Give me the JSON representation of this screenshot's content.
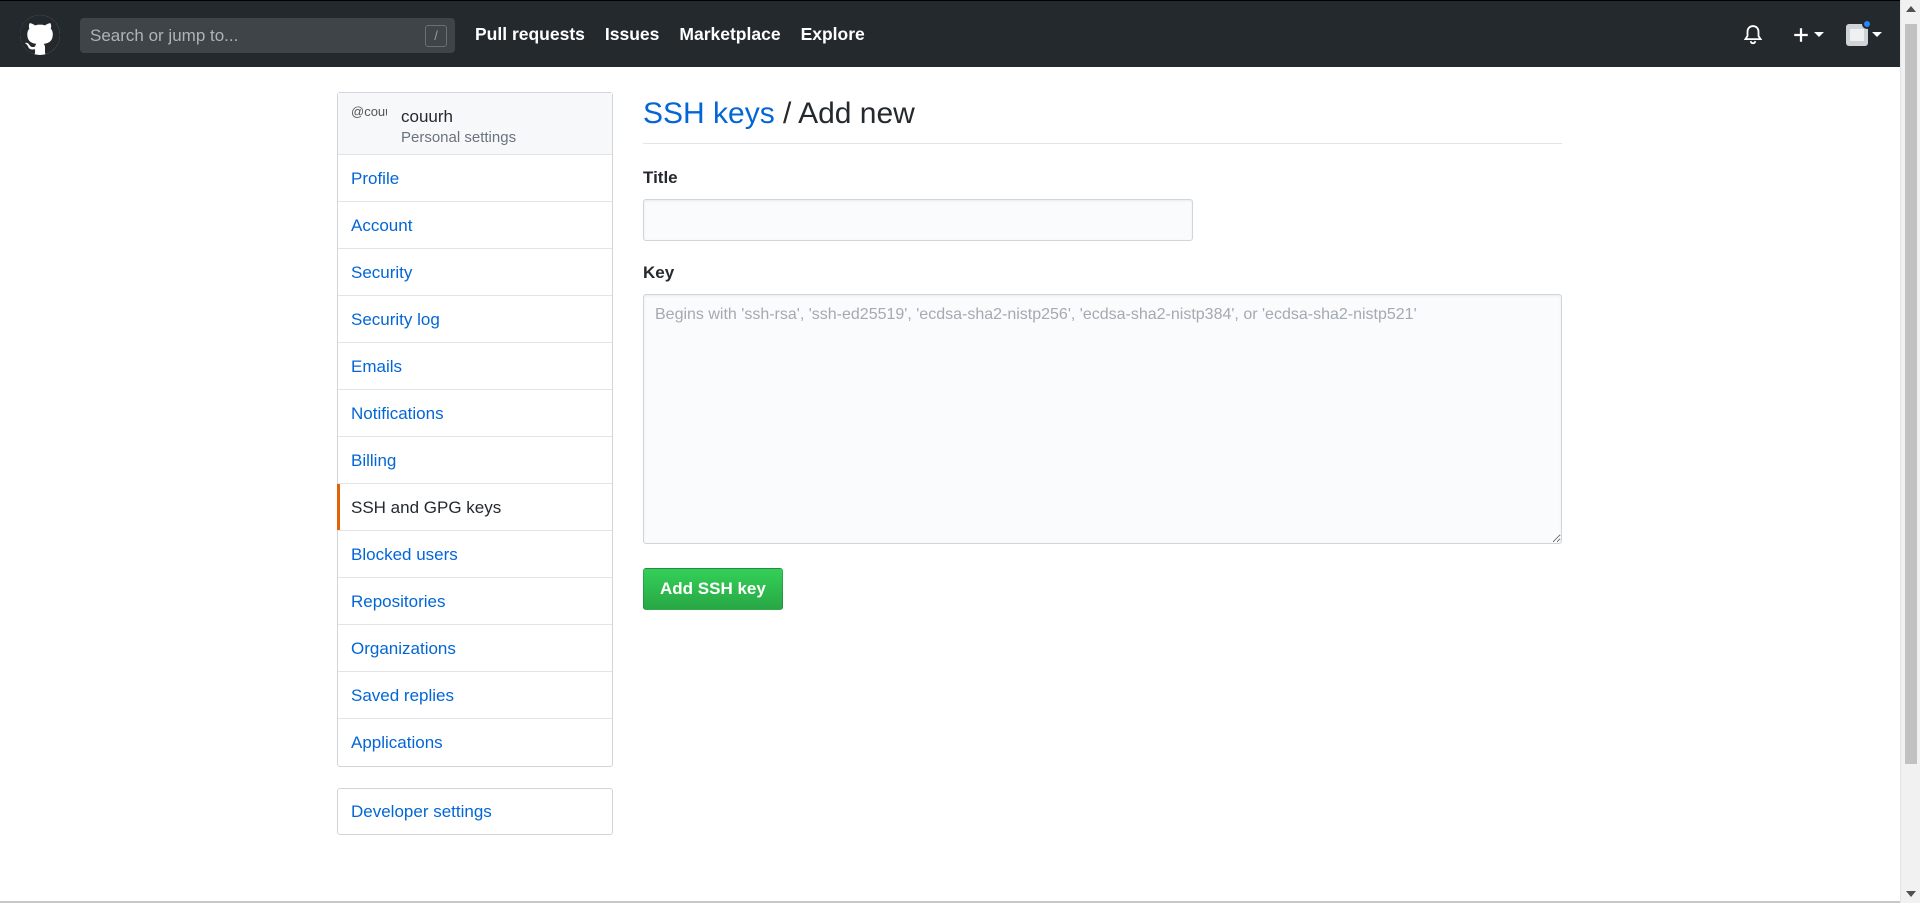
{
  "header": {
    "search_placeholder": "Search or jump to...",
    "search_shortcut": "/",
    "nav": [
      "Pull requests",
      "Issues",
      "Marketplace",
      "Explore"
    ],
    "colors": {
      "background": "#24292e",
      "notification_dot": "#2188ff"
    },
    "icons": [
      "github-logo-icon",
      "bell-icon",
      "plus-icon",
      "avatar"
    ]
  },
  "sidebar": {
    "user": {
      "name": "couurh",
      "subtitle": "Personal settings",
      "avatar_alt": "@couurh"
    },
    "items": [
      {
        "label": "Profile"
      },
      {
        "label": "Account"
      },
      {
        "label": "Security"
      },
      {
        "label": "Security log"
      },
      {
        "label": "Emails"
      },
      {
        "label": "Notifications"
      },
      {
        "label": "Billing"
      },
      {
        "label": "SSH and GPG keys",
        "selected": true
      },
      {
        "label": "Blocked users"
      },
      {
        "label": "Repositories"
      },
      {
        "label": "Organizations"
      },
      {
        "label": "Saved replies"
      },
      {
        "label": "Applications"
      }
    ],
    "developer": "Developer settings",
    "selected_accent": "#e36209"
  },
  "main": {
    "crumb_link": "SSH keys",
    "crumb_sep": " / ",
    "crumb_current": "Add new",
    "title_label": "Title",
    "title_value": "",
    "key_label": "Key",
    "key_placeholder": "Begins with 'ssh-rsa', 'ssh-ed25519', 'ecdsa-sha2-nistp256', 'ecdsa-sha2-nistp384', or 'ecdsa-sha2-nistp521'",
    "submit": "Add SSH key",
    "button_color": "#28a745"
  }
}
